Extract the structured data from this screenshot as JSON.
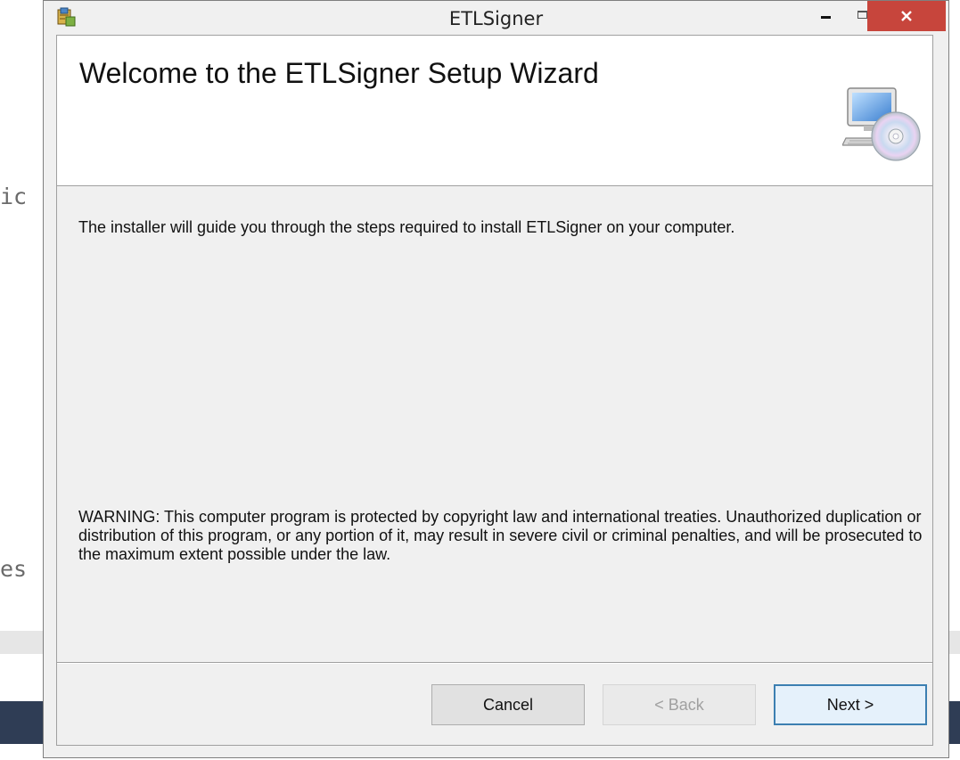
{
  "background": {
    "fragment_top": "ic",
    "fragment_bottom": "es"
  },
  "window": {
    "title": "ETLSigner",
    "controls": {
      "minimize_icon": "minimize-icon",
      "maximize_icon": "maximize-icon",
      "close_glyph": "✕"
    }
  },
  "banner": {
    "title": "Welcome to the ETLSigner Setup Wizard",
    "icon": "computer-disc-icon"
  },
  "body": {
    "intro": "The installer will guide you through the steps required to install ETLSigner on your computer.",
    "warning": "WARNING: This computer program is protected by copyright law and international treaties. Unauthorized duplication or distribution of this program, or any portion of it, may result in severe civil or criminal penalties, and will be prosecuted to the maximum extent possible under the law."
  },
  "buttons": {
    "cancel": "Cancel",
    "back": "< Back",
    "next": "Next >"
  },
  "colors": {
    "close_button": "#c7453c",
    "next_border": "#3c7fb1"
  }
}
